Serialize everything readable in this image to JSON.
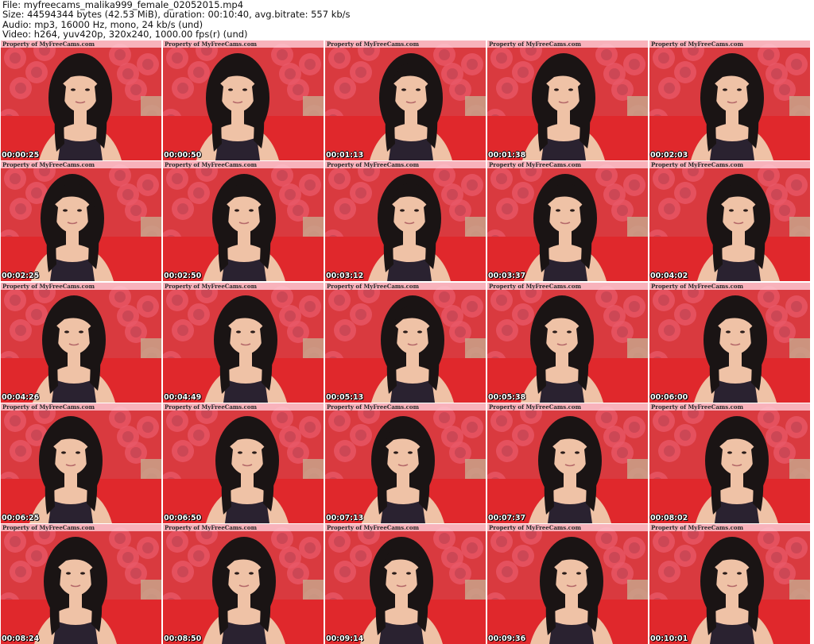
{
  "header": {
    "file": "File: myfreecams_malika999_female_02052015.mp4",
    "size": "Size: 44594344 bytes (42.53 MiB), duration: 00:10:40, avg.bitrate: 557 kb/s",
    "audio": "Audio: mp3, 16000 Hz, mono, 24 kb/s (und)",
    "video": "Video: h264, yuv420p, 320x240, 1000.00 fps(r) (und)"
  },
  "watermark": "Property of MyFreeCams.com",
  "colors": {
    "background_red": "#d93a3f",
    "rose_pattern": "#e85a6a",
    "sofa_red": "#e0282c",
    "hair": "#1a1414",
    "skin": "#efc2a6",
    "wall": "#c9a38a"
  },
  "thumbnails": [
    {
      "timestamp": "00:00:25"
    },
    {
      "timestamp": "00:00:50"
    },
    {
      "timestamp": "00:01:13"
    },
    {
      "timestamp": "00:01:38"
    },
    {
      "timestamp": "00:02:03"
    },
    {
      "timestamp": "00:02:25"
    },
    {
      "timestamp": "00:02:50"
    },
    {
      "timestamp": "00:03:12"
    },
    {
      "timestamp": "00:03:37"
    },
    {
      "timestamp": "00:04:02"
    },
    {
      "timestamp": "00:04:26"
    },
    {
      "timestamp": "00:04:49"
    },
    {
      "timestamp": "00:05:13"
    },
    {
      "timestamp": "00:05:38"
    },
    {
      "timestamp": "00:06:00"
    },
    {
      "timestamp": "00:06:25"
    },
    {
      "timestamp": "00:06:50"
    },
    {
      "timestamp": "00:07:13"
    },
    {
      "timestamp": "00:07:37"
    },
    {
      "timestamp": "00:08:02"
    },
    {
      "timestamp": "00:08:24"
    },
    {
      "timestamp": "00:08:50"
    },
    {
      "timestamp": "00:09:14"
    },
    {
      "timestamp": "00:09:36"
    },
    {
      "timestamp": "00:10:01"
    }
  ]
}
